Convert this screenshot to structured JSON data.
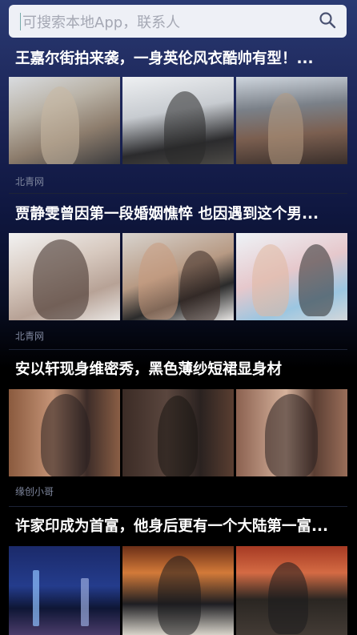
{
  "search": {
    "placeholder": "可搜索本地App，联系人"
  },
  "news": [
    {
      "title": "王嘉尔街拍来袭，一身英伦风衣酷帅有型！...",
      "source": "北青网"
    },
    {
      "title": "贾静雯曾因第一段婚姻憔悴 也因遇到这个男...",
      "source": "北青网"
    },
    {
      "title": "安以轩现身维密秀，黑色薄纱短裙显身材",
      "source": "缘创小哥"
    },
    {
      "title": "许家印成为首富，他身后更有一个大陆第一富...",
      "source": ""
    }
  ],
  "colors": {
    "background_top": "#2a3a73",
    "background_bottom": "#000000",
    "source_text": "#7f879e"
  }
}
